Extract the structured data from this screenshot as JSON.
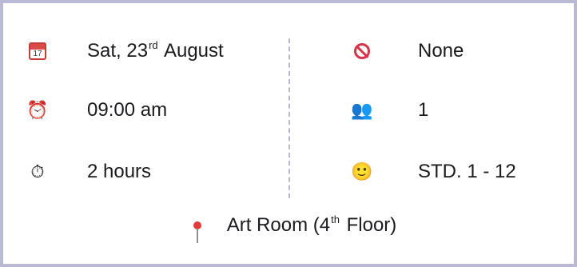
{
  "details": {
    "date": {
      "prefix": "Sat, 23",
      "suffix": "rd",
      "rest": " August",
      "icon": "calendar-icon"
    },
    "time": {
      "text": "09:00 am",
      "icon": "alarm-clock-icon"
    },
    "duration": {
      "text": "2 hours",
      "icon": "stopwatch-icon"
    },
    "restriction": {
      "text": "None",
      "icon": "no-entry-icon"
    },
    "participants": {
      "text": "1",
      "icon": "people-icon"
    },
    "grade": {
      "text": "STD. 1 - 12",
      "icon": "student-face-icon"
    },
    "location": {
      "prefix": "Art Room (4",
      "suffix": "th",
      "rest": " Floor)",
      "icon": "pin-icon"
    }
  },
  "colors": {
    "border": "#b9b9d6",
    "divider": "#b7b7d3",
    "accent_red": "#d6334a",
    "text": "#1b1b1f"
  }
}
